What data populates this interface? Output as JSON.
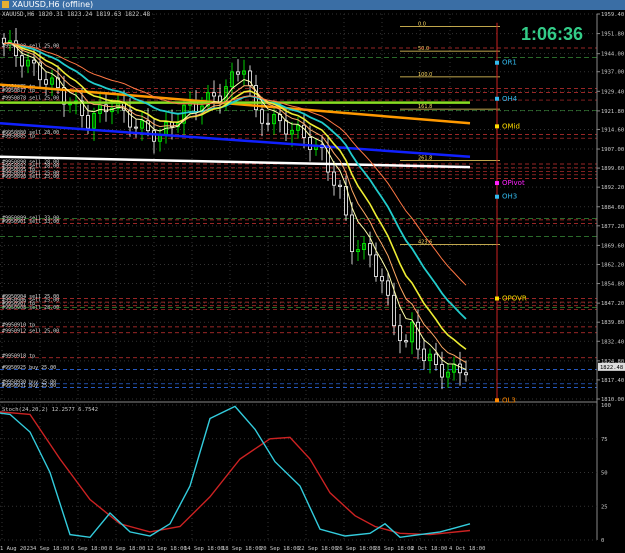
{
  "window": {
    "title": "XAUUSD,H6 (offline)"
  },
  "main": {
    "info": "XAUUSD,H6  1820.31 1823.24 1819.63 1822.48",
    "timer": "1:06:36",
    "colors": {
      "bg": "#000000",
      "bull": "#00ff00",
      "bear": "#ffffff",
      "ema_white": "#ffffff",
      "ema_blue": "#1020ff",
      "ema_orange": "#ff9900",
      "ema_green": "#88dd22",
      "ema_cyan": "#22cccc",
      "ema_yellow": "#eeee33",
      "pivot_line": "#cc2222",
      "timer": "#33cc88"
    },
    "price_axis": {
      "min": 1810.0,
      "max": 1959.4,
      "ticks": [
        "1959.40",
        "1951.80",
        "1944.00",
        "1937.00",
        "1929.40",
        "1921.80",
        "1914.60",
        "1907.00",
        "1899.60",
        "1892.20",
        "1884.60",
        "1877.20",
        "1869.60",
        "1862.20",
        "1854.80",
        "1847.20",
        "1839.80",
        "1832.40",
        "1824.80",
        "1817.40",
        "1810.00"
      ],
      "current_price": "1822.48"
    },
    "pivots": [
      {
        "label": "OR1",
        "price": 1940.5,
        "color": "#33bbee"
      },
      {
        "label": "OH4",
        "price": 1926.5,
        "color": "#33bbee"
      },
      {
        "label": "OMid",
        "price": 1915.8,
        "color": "#ffdd00"
      },
      {
        "label": "OPivot",
        "price": 1893.8,
        "color": "#ff22ff"
      },
      {
        "label": "OH3",
        "price": 1888.5,
        "color": "#33bbee"
      },
      {
        "label": "OPOVR",
        "price": 1849.0,
        "color": "#ffdd00"
      },
      {
        "label": "OL3",
        "price": 1809.5,
        "color": "#ff8800"
      }
    ],
    "fibs": [
      {
        "label": "0.0",
        "price": 1954.5
      },
      {
        "label": "50.0",
        "price": 1945.0
      },
      {
        "label": "100.0",
        "price": 1935.0
      },
      {
        "label": "161.8",
        "price": 1922.5
      },
      {
        "label": "261.8",
        "price": 1902.5
      },
      {
        "label": "423.6",
        "price": 1870.0
      }
    ],
    "order_labels": [
      {
        "text": "#9950808 sell 25.00",
        "price": 1946.2
      },
      {
        "text": "#9950875 tp",
        "price": 1930.5
      },
      {
        "text": "#9950877 tp",
        "price": 1929.0
      },
      {
        "text": "#9950878 sell 25.00",
        "price": 1926.0
      },
      {
        "text": "#9950880 sell 28.00",
        "price": 1912.6
      },
      {
        "text": "#9950885 tp",
        "price": 1911.2
      },
      {
        "text": "#9950890 sell 28.00",
        "price": 1901.2
      },
      {
        "text": "#9950892 sell 28.00",
        "price": 1899.7
      },
      {
        "text": "#9950895 tp",
        "price": 1898.3
      },
      {
        "text": "#9950897 sell 25.00",
        "price": 1897.0
      },
      {
        "text": "#9950898 sell 25.00",
        "price": 1895.6
      },
      {
        "text": "#9950899 sell 33.00",
        "price": 1879.5
      },
      {
        "text": "#9950901 sell 33.00",
        "price": 1878.1
      },
      {
        "text": "#9950904 sell 25.00",
        "price": 1849.0
      },
      {
        "text": "#9950906 sell 25.00",
        "price": 1847.6
      },
      {
        "text": "#9950907 tp",
        "price": 1846.2
      },
      {
        "text": "#9950908 sell 28.00",
        "price": 1844.8
      },
      {
        "text": "#9950910 tp",
        "price": 1838.0
      },
      {
        "text": "#9950912 sell 25.00",
        "price": 1835.7
      },
      {
        "text": "#9950918 tp",
        "price": 1826.0
      },
      {
        "text": "#9950925 buy 25.00",
        "price": 1821.4
      },
      {
        "text": "#9950930 buy 25.00",
        "price": 1815.9
      },
      {
        "text": "#9950931 buy 25.00",
        "price": 1814.5
      }
    ],
    "stoch": {
      "label": "Stoch(24,20,2)  12.2577  6.7542",
      "ticks": [
        "100",
        "75",
        "50",
        "25",
        "0"
      ]
    },
    "time_axis": [
      "1 Aug 2023",
      "4 Sep 18:00",
      "6 Sep 18:00",
      "8 Sep 18:00",
      "12 Sep 18:00",
      "14 Sep 18:00",
      "18 Sep 18:00",
      "20 Sep 18:00",
      "22 Sep 18:00",
      "26 Sep 18:00",
      "28 Sep 18:00",
      "2 Oct 18:00",
      "4 Oct 18:00"
    ]
  }
}
